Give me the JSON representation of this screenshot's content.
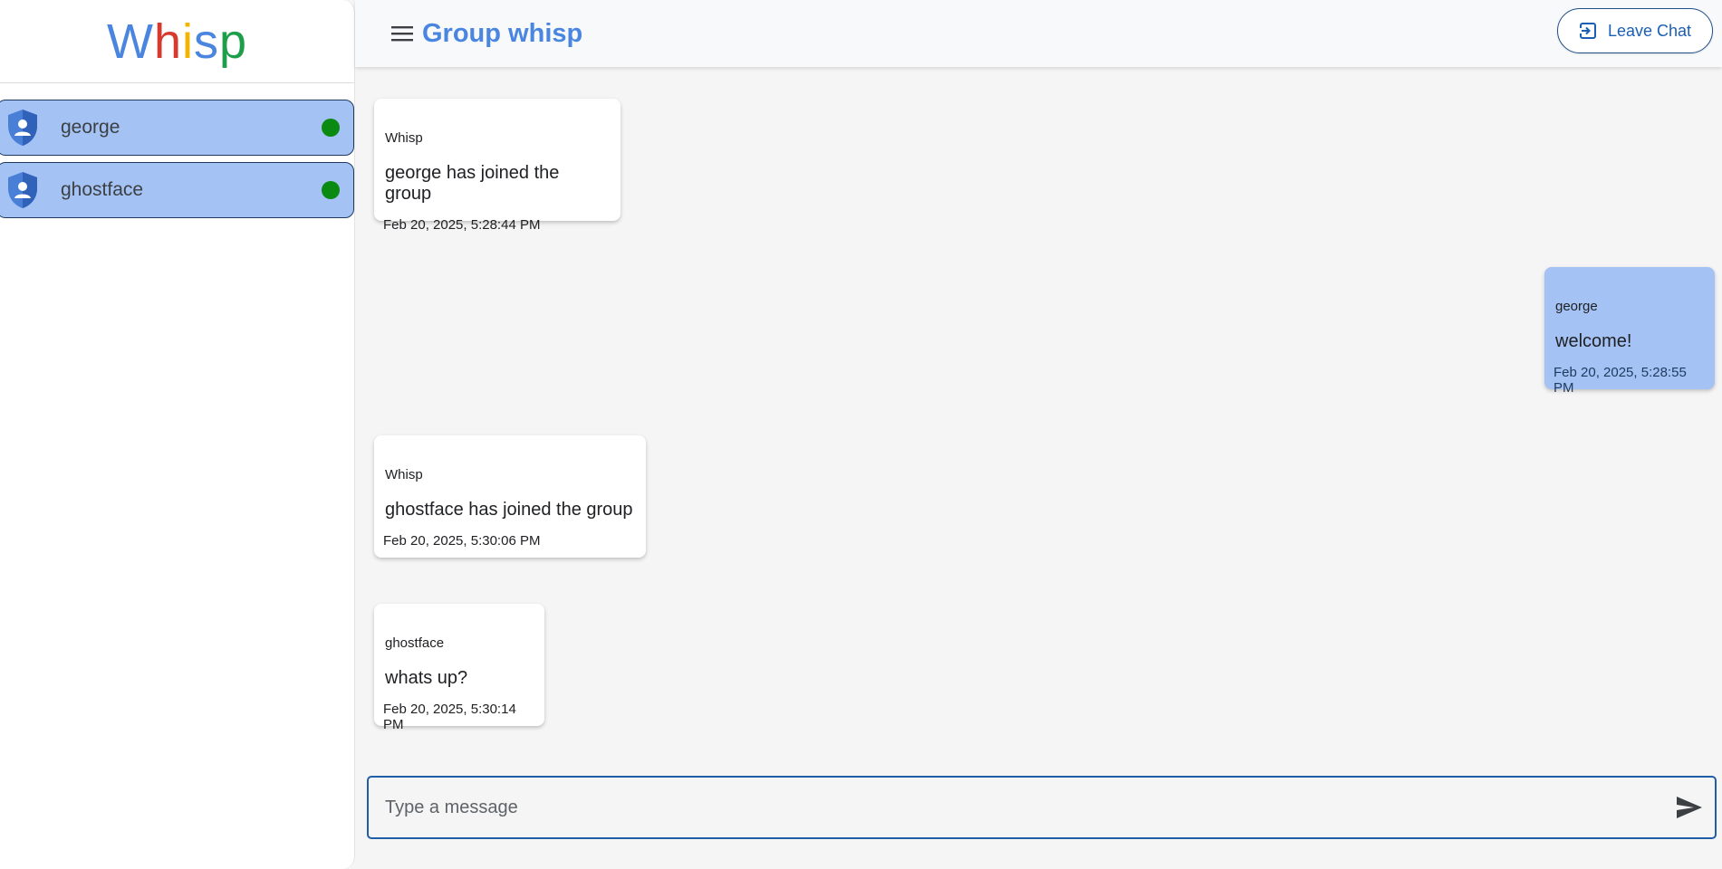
{
  "app": {
    "logo_letters": [
      "W",
      "h",
      "i",
      "s",
      "p"
    ],
    "logo_colors": [
      "#4a86e0",
      "#d63a2f",
      "#f4b400",
      "#4a86e0",
      "#1e9e4a"
    ]
  },
  "sidebar": {
    "users": [
      {
        "name": "george",
        "status": "online"
      },
      {
        "name": "ghostface",
        "status": "online"
      }
    ]
  },
  "header": {
    "title": "Group whisp",
    "leave_label": "Leave Chat"
  },
  "messages": [
    {
      "sender": "Whisp",
      "text": "george has joined the group",
      "time": "Feb 20, 2025, 5:28:44 PM",
      "mine": false
    },
    {
      "sender": "george",
      "text": "welcome!",
      "time": "Feb 20, 2025, 5:28:55 PM",
      "mine": true
    },
    {
      "sender": "Whisp",
      "text": "ghostface has joined the group",
      "time": "Feb 20, 2025, 5:30:06 PM",
      "mine": false
    },
    {
      "sender": "ghostface",
      "text": "whats up?",
      "time": "Feb 20, 2025, 5:30:14 PM",
      "mine": false
    }
  ],
  "composer": {
    "placeholder": "Type a message"
  },
  "colors": {
    "accent": "#4a86e0",
    "bubble_mine": "#a4c2f4",
    "online": "#0b8a12"
  }
}
